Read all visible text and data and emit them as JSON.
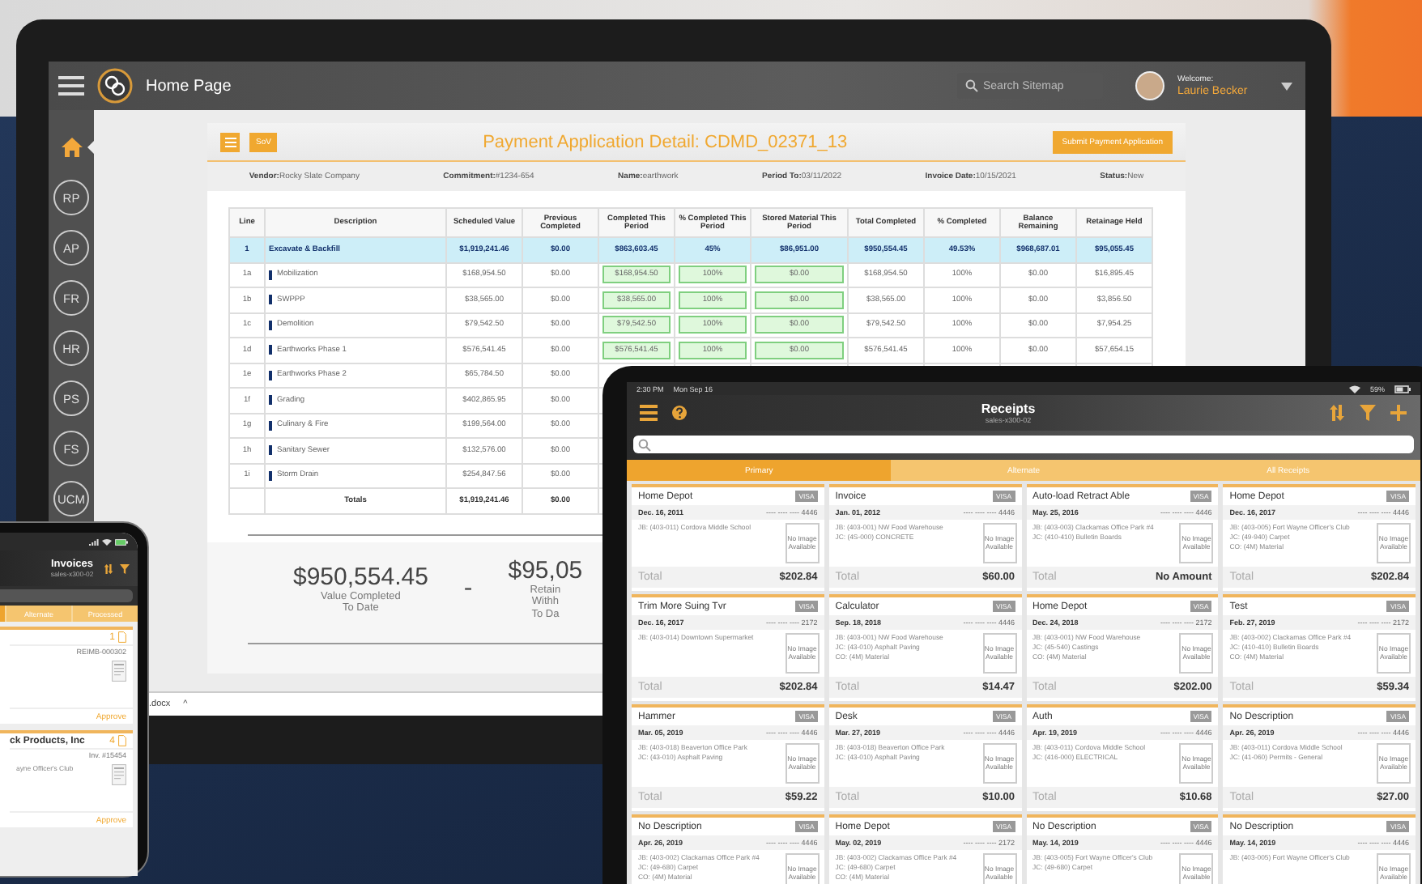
{
  "laptop": {
    "header": {
      "title": "Home Page",
      "search_placeholder": "Search Sitemap",
      "welcome": "Welcome:",
      "user": "Laurie Becker"
    },
    "sidebar": [
      {
        "kind": "home",
        "selected": true
      },
      {
        "kind": "circle",
        "label": "RP",
        "selected": false
      },
      {
        "kind": "circle",
        "label": "AP",
        "selected": false
      },
      {
        "kind": "circle",
        "label": "FR",
        "selected": false
      },
      {
        "kind": "circle",
        "label": "HR",
        "selected": false
      },
      {
        "kind": "circle",
        "label": "PS",
        "selected": false
      },
      {
        "kind": "circle",
        "label": "FS",
        "selected": false
      },
      {
        "kind": "circle",
        "label": "UCM",
        "selected": false
      }
    ],
    "panel": {
      "sov_button": "SoV",
      "title": "Payment Application Detail: CDMD_02371_13",
      "submit_button": "Submit Payment Application",
      "info": [
        {
          "label": "Vendor:",
          "value": "Rocky Slate Company"
        },
        {
          "label": "Commitment:",
          "value": "#1234-654"
        },
        {
          "label": "Name:",
          "value": "earthwork"
        },
        {
          "label": "Period To:",
          "value": "03/11/2022"
        },
        {
          "label": "Invoice Date:",
          "value": "10/15/2021"
        },
        {
          "label": "Status:",
          "value": "New"
        }
      ],
      "table": {
        "columns": [
          {
            "label": "Line",
            "editable": false
          },
          {
            "label": "Description",
            "editable": false
          },
          {
            "label": "Scheduled Value",
            "editable": false
          },
          {
            "label": "Previous Completed",
            "editable": false
          },
          {
            "label": "Completed This Period",
            "editable": true
          },
          {
            "label": "% Completed This Period",
            "editable": true
          },
          {
            "label": "Stored Material This Period",
            "editable": true
          },
          {
            "label": "Total Completed",
            "editable": false
          },
          {
            "label": "% Completed",
            "editable": false
          },
          {
            "label": "Balance Remaining",
            "editable": false
          },
          {
            "label": "Retainage Held",
            "editable": false
          }
        ],
        "rows": [
          {
            "kind": "group",
            "cells": [
              "1",
              "Excavate & Backfill",
              "$1,919,241.46",
              "$0.00",
              "$863,603.45",
              "45%",
              "$86,951.00",
              "$950,554.45",
              "49.53%",
              "$968,687.01",
              "$95,055.45"
            ]
          },
          {
            "kind": "item",
            "cells": [
              "1a",
              "Mobilization",
              "$168,954.50",
              "$0.00",
              "$168,954.50",
              "100%",
              "$0.00",
              "$168,954.50",
              "100%",
              "$0.00",
              "$16,895.45"
            ]
          },
          {
            "kind": "item",
            "cells": [
              "1b",
              "SWPPP",
              "$38,565.00",
              "$0.00",
              "$38,565.00",
              "100%",
              "$0.00",
              "$38,565.00",
              "100%",
              "$0.00",
              "$3,856.50"
            ]
          },
          {
            "kind": "item",
            "cells": [
              "1c",
              "Demolition",
              "$79,542.50",
              "$0.00",
              "$79,542.50",
              "100%",
              "$0.00",
              "$79,542.50",
              "100%",
              "$0.00",
              "$7,954.25"
            ]
          },
          {
            "kind": "item",
            "cells": [
              "1d",
              "Earthworks Phase 1",
              "$576,541.45",
              "$0.00",
              "$576,541.45",
              "100%",
              "$0.00",
              "$576,541.45",
              "100%",
              "$0.00",
              "$57,654.15"
            ]
          },
          {
            "kind": "item",
            "cells": [
              "1e",
              "Earthworks Phase 2",
              "$65,784.50",
              "$0.00"
            ]
          },
          {
            "kind": "item",
            "cells": [
              "1f",
              "Grading",
              "$402,865.95",
              "$0.00"
            ]
          },
          {
            "kind": "item",
            "cells": [
              "1g",
              "Culinary & Fire",
              "$199,564.00",
              "$0.00"
            ]
          },
          {
            "kind": "item",
            "cells": [
              "1h",
              "Sanitary Sewer",
              "$132,576.00",
              "$0.00"
            ]
          },
          {
            "kind": "item",
            "cells": [
              "1i",
              "Storm Drain",
              "$254,847.56",
              "$0.00"
            ]
          },
          {
            "kind": "total",
            "cells": [
              "",
              "Totals",
              "$1,919,241.46",
              "$0.00"
            ]
          }
        ]
      },
      "summary": [
        {
          "value": "$950,554.45",
          "label": [
            "Value Completed",
            "To Date"
          ]
        },
        {
          "value": "$95,05",
          "label": [
            "Retain",
            "Withh",
            "To Da"
          ]
        }
      ],
      "summary_separator": "-"
    },
    "download_bar": {
      "file": ".docx",
      "caret": "^"
    }
  },
  "phone": {
    "title": "Invoices",
    "subtitle": "sales-x300-02",
    "tabs": [
      {
        "label": "Alternate",
        "selected": false
      },
      {
        "label": "Processed",
        "selected": false
      }
    ],
    "cards": [
      {
        "count": "1",
        "reference": "REIMB-000302",
        "action": "Approve"
      },
      {
        "title": "ck Products, Inc",
        "count": "4",
        "reference": "Inv. #15454",
        "lines": [
          "ayne Officer's Club"
        ],
        "action": "Approve"
      }
    ]
  },
  "tablet": {
    "status": {
      "time": "2:30 PM",
      "date": "Mon Sep 16",
      "battery": "59%"
    },
    "title": "Receipts",
    "subtitle": "sales-x300-02",
    "tabs": [
      {
        "label": "Primary",
        "selected": true
      },
      {
        "label": "Alternate",
        "selected": false
      },
      {
        "label": "All Receipts",
        "selected": false
      }
    ],
    "cards": [
      {
        "title": "Home Depot",
        "badge": "VISA",
        "date": "Dec. 16, 2011",
        "card_number": "---- ---- ---- 4446",
        "lines": [
          "JB: (403-011) Cordova Middle School"
        ],
        "thumbnail": "No Image Available",
        "total_label": "Total",
        "amount": "$202.84"
      },
      {
        "title": "Invoice",
        "badge": "VISA",
        "date": "Jan. 01, 2012",
        "card_number": "---- ---- ---- 4446",
        "lines": [
          "JB: (403-001) NW Food Warehouse",
          "JC: (4S-000) CONCRETE"
        ],
        "thumbnail": "No Image Available",
        "total_label": "Total",
        "amount": "$60.00"
      },
      {
        "title": "Auto-load Retract Able",
        "badge": "VISA",
        "date": "May. 25, 2016",
        "card_number": "---- ---- ---- 4446",
        "lines": [
          "JB: (403-003) Clackamas Office Park #4",
          "JC: (410-410) Bulletin Boards"
        ],
        "thumbnail": "No Image Available",
        "total_label": "Total",
        "amount": "No Amount"
      },
      {
        "title": "Home Depot",
        "badge": "VISA",
        "date": "Dec. 16, 2017",
        "card_number": "---- ---- ---- 4446",
        "lines": [
          "JB: (403-005) Fort Wayne Officer's Club",
          "JC: (49-940) Carpet",
          "CO: (4M) Material"
        ],
        "thumbnail": "No Image Available",
        "total_label": "Total",
        "amount": "$202.84"
      },
      {
        "title": "Trim More Suing Tvr",
        "badge": "VISA",
        "date": "Dec. 16, 2017",
        "card_number": "---- ---- ---- 2172",
        "lines": [
          "JB: (403-014) Downtown Supermarket"
        ],
        "thumbnail": "No Image Available",
        "total_label": "Total",
        "amount": "$202.84"
      },
      {
        "title": "Calculator",
        "badge": "VISA",
        "date": "Sep. 18, 2018",
        "card_number": "---- ---- ---- 4446",
        "lines": [
          "JB: (403-001) NW Food Warehouse",
          "JC: (43-010) Asphalt Paving",
          "CO: (4M) Material"
        ],
        "thumbnail": "No Image Available",
        "total_label": "Total",
        "amount": "$14.47"
      },
      {
        "title": "Home Depot",
        "badge": "VISA",
        "date": "Dec. 24, 2018",
        "card_number": "---- ---- ---- 2172",
        "lines": [
          "JB: (403-001) NW Food Warehouse",
          "JC: (45-540) Castings",
          "CO: (4M) Material"
        ],
        "thumbnail": "No Image Available",
        "total_label": "Total",
        "amount": "$202.00"
      },
      {
        "title": "Test",
        "badge": "VISA",
        "date": "Feb. 27, 2019",
        "card_number": "---- ---- ---- 2172",
        "lines": [
          "JB: (403-002) Clackamas Office Park #4",
          "JC: (410-410) Bulletin Boards",
          "CO: (4M) Material"
        ],
        "thumbnail": "No Image Available",
        "total_label": "Total",
        "amount": "$59.34"
      },
      {
        "title": "Hammer",
        "badge": "VISA",
        "date": "Mar. 05, 2019",
        "card_number": "---- ---- ---- 4446",
        "lines": [
          "JB: (403-018) Beaverton Office Park",
          "JC: (43-010) Asphalt Paving"
        ],
        "thumbnail": "No Image Available",
        "total_label": "Total",
        "amount": "$59.22"
      },
      {
        "title": "Desk",
        "badge": "VISA",
        "date": "Mar. 27, 2019",
        "card_number": "---- ---- ---- 4446",
        "lines": [
          "JB: (403-018) Beaverton Office Park",
          "JC: (43-010) Asphalt Paving"
        ],
        "thumbnail": "No Image Available",
        "total_label": "Total",
        "amount": "$10.00"
      },
      {
        "title": "Auth",
        "badge": "VISA",
        "date": "Apr. 19, 2019",
        "card_number": "---- ---- ---- 4446",
        "lines": [
          "JB: (403-011) Cordova Middle School",
          "JC: (416-000) ELECTRICAL"
        ],
        "thumbnail": "No Image Available",
        "total_label": "Total",
        "amount": "$10.68"
      },
      {
        "title": "No Description",
        "badge": "VISA",
        "date": "Apr. 26, 2019",
        "card_number": "---- ---- ---- 4446",
        "lines": [
          "JB: (403-011) Cordova Middle School",
          "JC: (41-060) Permits - General"
        ],
        "thumbnail": "No Image Available",
        "total_label": "Total",
        "amount": "$27.00"
      },
      {
        "title": "No Description",
        "badge": "VISA",
        "date": "Apr. 26, 2019",
        "card_number": "---- ---- ---- 4446",
        "lines": [
          "JB: (403-002) Clackamas Office Park #4",
          "JC: (49-680) Carpet",
          "CO: (4M) Material"
        ],
        "thumbnail": "No Image Available"
      },
      {
        "title": "Home Depot",
        "badge": "VISA",
        "date": "May. 02, 2019",
        "card_number": "---- ---- ---- 2172",
        "lines": [
          "JB: (403-002) Clackamas Office Park #4",
          "JC: (49-680) Carpet",
          "CO: (4M) Material"
        ],
        "thumbnail": "No Image Available"
      },
      {
        "title": "No Description",
        "badge": "VISA",
        "date": "May. 14, 2019",
        "card_number": "---- ---- ---- 4446",
        "lines": [
          "JB: (403-005) Fort Wayne Officer's Club",
          "JC: (49-680) Carpet"
        ],
        "thumbnail": "No Image Available"
      },
      {
        "title": "No Description",
        "badge": "VISA",
        "date": "May. 14, 2019",
        "card_number": "---- ---- ---- 4446",
        "lines": [
          "JB: (403-005) Fort Wayne Officer's Club"
        ],
        "thumbnail": "No Image Available"
      }
    ]
  }
}
